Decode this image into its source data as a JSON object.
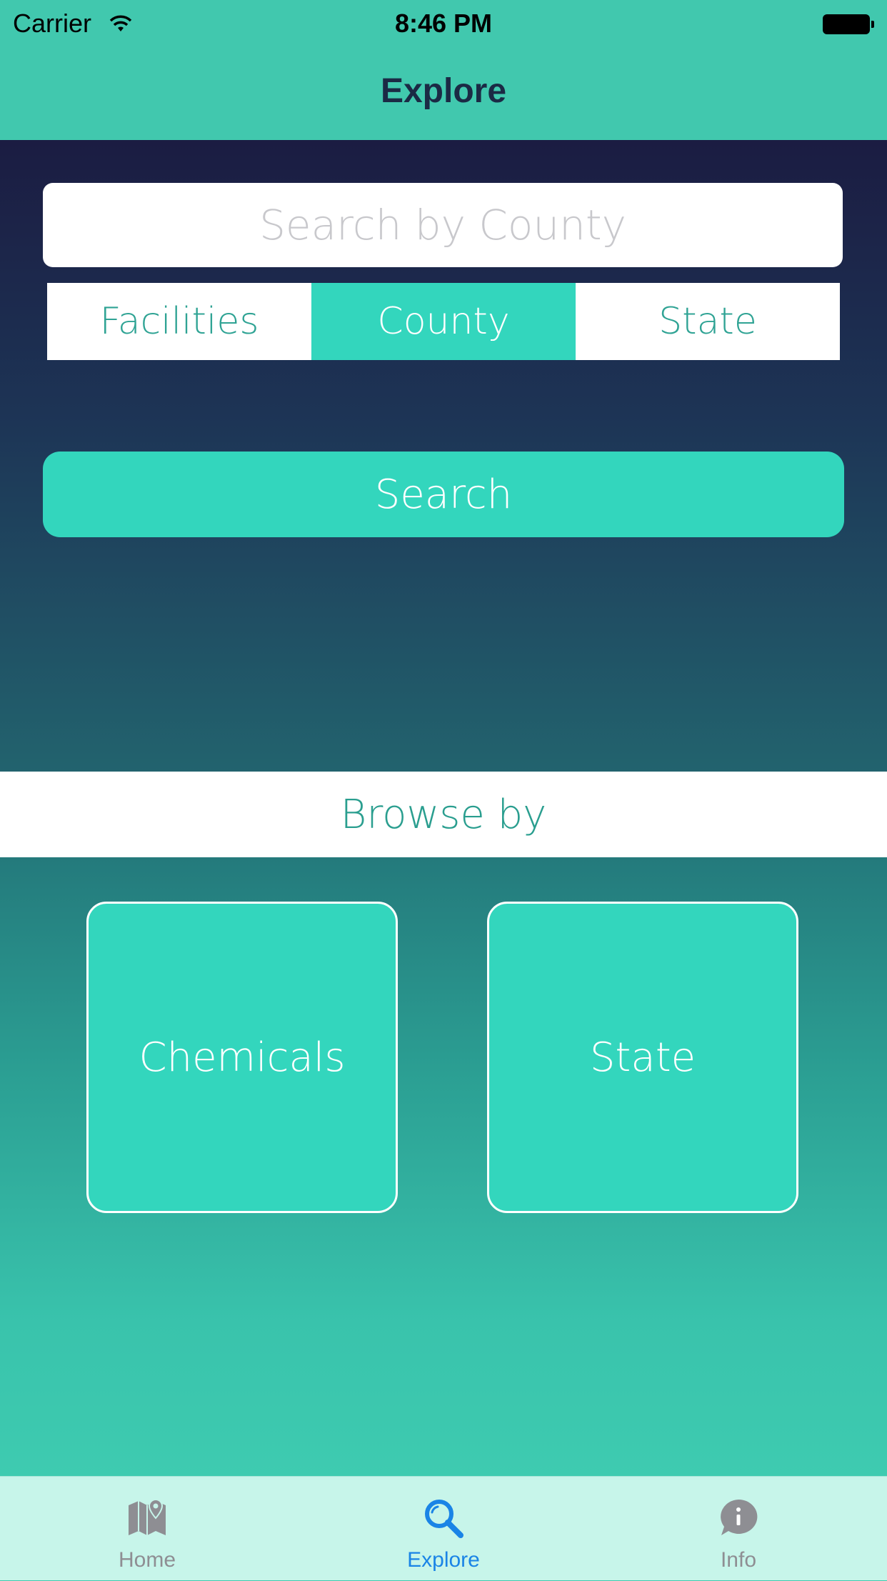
{
  "status": {
    "carrier": "Carrier",
    "time": "8:46 PM"
  },
  "nav": {
    "title": "Explore"
  },
  "search": {
    "placeholder": "Search by County",
    "segments": [
      "Facilities",
      "County",
      "State"
    ],
    "selected_segment": "County",
    "button_label": "Search"
  },
  "browse": {
    "header": "Browse by",
    "tiles": [
      "Chemicals",
      "State"
    ]
  },
  "tabs": [
    {
      "label": "Home",
      "icon": "map-icon",
      "active": false
    },
    {
      "label": "Explore",
      "icon": "search-icon",
      "active": true
    },
    {
      "label": "Info",
      "icon": "info-bubble-icon",
      "active": false
    }
  ],
  "colors": {
    "accent": "#33d6bd",
    "nav_bg": "#41c8ae",
    "title": "#1b2a45",
    "tab_active": "#1a84e6",
    "tab_inactive": "#8e8e93"
  }
}
